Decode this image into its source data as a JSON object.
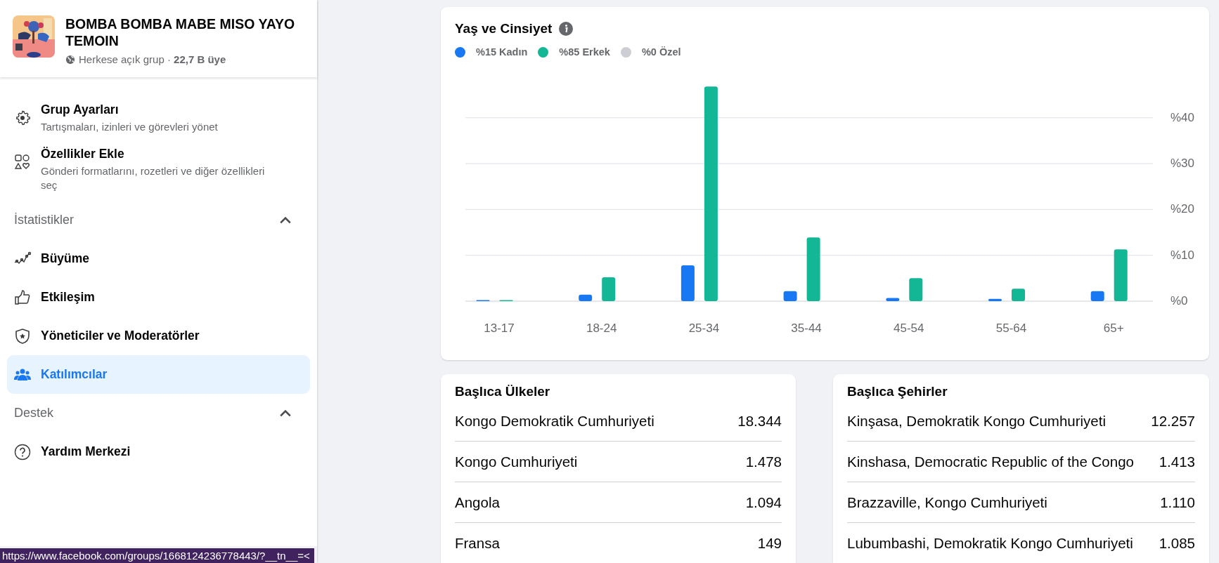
{
  "group": {
    "name": "BOMBA BOMBA MABE MISO YAYO TEMOIN",
    "privacy": "Herkese açık grup",
    "separator": "·",
    "members": "22,7 B üye"
  },
  "settings_items": [
    {
      "label": "Grup Ayarları",
      "description": "Tartışmaları, izinleri ve görevleri yönet",
      "selected": false
    },
    {
      "label": "Özellikler Ekle",
      "description": "Gönderi formatlarını, rozetleri ve diğer özellikleri seç",
      "selected": false
    }
  ],
  "sections": [
    {
      "title": "İstatistikler",
      "expanded": true,
      "items": [
        {
          "label": "Büyüme",
          "selected": false
        },
        {
          "label": "Etkileşim",
          "selected": false
        },
        {
          "label": "Yöneticiler ve Moderatörler",
          "selected": false
        },
        {
          "label": "Katılımcılar",
          "selected": true
        }
      ]
    },
    {
      "title": "Destek",
      "expanded": true,
      "items": [
        {
          "label": "Yardım Merkezi",
          "selected": false
        }
      ]
    }
  ],
  "status_url": "https://www.facebook.com/groups/1668124236778443/?__tn__=<",
  "age_gender": {
    "title": "Yaş ve Cinsiyet",
    "chart_data": {
      "type": "bar",
      "categories": [
        "13-17",
        "18-24",
        "25-34",
        "35-44",
        "45-54",
        "55-64",
        "65+"
      ],
      "series": [
        {
          "name": "%15 Kadın",
          "color": "#1877f2",
          "values": [
            0.1,
            1.4,
            7.8,
            2.2,
            0.7,
            0.5,
            2.2
          ]
        },
        {
          "name": "%85 Erkek",
          "color": "#14b795",
          "values": [
            0.2,
            5.2,
            46.8,
            13.9,
            5.0,
            2.7,
            11.3
          ]
        },
        {
          "name": "%0 Özel",
          "color": "#ccced3",
          "values": [
            0,
            0,
            0,
            0,
            0,
            0,
            0
          ]
        }
      ],
      "grid": true,
      "ylim": [
        0,
        47
      ],
      "yticks": [
        {
          "value": 0,
          "label": "%0"
        },
        {
          "value": 10,
          "label": "%10"
        },
        {
          "value": 20,
          "label": "%20"
        },
        {
          "value": 30,
          "label": "%30"
        },
        {
          "value": 40,
          "label": "%40"
        }
      ]
    }
  },
  "top_countries": {
    "title": "Başlıca Ülkeler",
    "rows": [
      {
        "name": "Kongo Demokratik Cumhuriyeti",
        "count": "18.344"
      },
      {
        "name": "Kongo Cumhuriyeti",
        "count": "1.478"
      },
      {
        "name": "Angola",
        "count": "1.094"
      },
      {
        "name": "Fransa",
        "count": "149"
      }
    ]
  },
  "top_cities": {
    "title": "Başlıca Şehirler",
    "rows": [
      {
        "name": "Kinşasa, Demokratik Kongo Cumhuriyeti",
        "count": "12.257"
      },
      {
        "name": "Kinshasa, Democratic Republic of the Congo",
        "count": "1.413"
      },
      {
        "name": "Brazzaville, Kongo Cumhuriyeti",
        "count": "1.110"
      },
      {
        "name": "Lubumbashi, Demokratik Kongo Cumhuriyeti",
        "count": "1.085"
      }
    ]
  }
}
